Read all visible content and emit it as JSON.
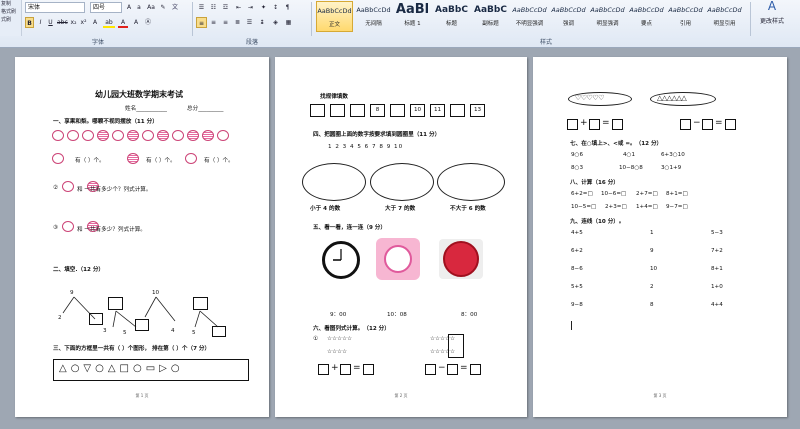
{
  "ribbon": {
    "clipboard_labels": [
      "复制",
      "格式刷",
      "式刷"
    ],
    "font_name": "宋体",
    "font_size": "四号",
    "font_group_label": "字体",
    "paragraph_group_label": "段落",
    "styles_group_label": "样式",
    "change_styles_label": "更改样式",
    "styles": [
      {
        "sample": "AaBbCcDd",
        "name": "正文"
      },
      {
        "sample": "AaBbCcDd",
        "name": "无间隔"
      },
      {
        "sample": "AaBl",
        "name": "标题 1"
      },
      {
        "sample": "AaBbC",
        "name": "标题"
      },
      {
        "sample": "AaBbC",
        "name": "副标题"
      },
      {
        "sample": "AaBbCcDd",
        "name": "不明显强调"
      },
      {
        "sample": "AaBbCcDd",
        "name": "强调"
      },
      {
        "sample": "AaBbCcDd",
        "name": "明显强调"
      },
      {
        "sample": "AaBbCcDd",
        "name": "要点"
      },
      {
        "sample": "AaBbCcDd",
        "name": "引用"
      },
      {
        "sample": "AaBbCcDd",
        "name": "明显引用"
      }
    ]
  },
  "page1": {
    "title": "幼儿园大班数学期末考试",
    "name_label": "姓名___________",
    "score_label": "总分_________",
    "s1": "一、享果和梨。哪颗不视同摆放（11 分）",
    "row_marks": [
      "有（    ）个。",
      "有（    ）个。",
      "有（    ）个。"
    ],
    "q2": "和       一共有多少个？列式计算。",
    "q3": "和       一共有多少？列式计算。",
    "s2": "二、填空.（12 分）",
    "tree1": {
      "top": "9",
      "left": "2",
      "mid": "3"
    },
    "tree2": {
      "top": "10",
      "left": "5",
      "mid": "4",
      "right": "5"
    },
    "s3": "三、下面的方框里一共有（    ）个图形，  排在第（    ）个（7 分）",
    "page_num": "第 1 页"
  },
  "page2": {
    "s_find": "找规律填数",
    "seq": [
      "",
      "",
      "",
      "8",
      "",
      "10",
      "11",
      "",
      "13"
    ],
    "s4": "四、把圆圈上面的数字按要求填到圆圈里（11 分）",
    "numbers": "1   2   3   4   5   6   7   8   9   10",
    "oval_labels": [
      "小于 4 的数",
      "大于 7 的数",
      "不大于 6 的数"
    ],
    "s5": "五、看一看，连一连（9 分）",
    "times": [
      "9：00",
      "10：08",
      "8：00"
    ],
    "s6": "六、看图列式计算。（12 分）",
    "q1": "①",
    "stars1": "☆☆☆☆☆",
    "stars2": "☆☆☆☆",
    "stars3": "☆☆☆☆☆",
    "stars4": "☆☆☆☆☆",
    "plus": "+",
    "minus": "−",
    "eq": "=",
    "page_num": "第 2 页"
  },
  "page3": {
    "s7": "七、在○填上>、<或 =。（12 分）",
    "compare": [
      [
        "9○6",
        "4○1",
        "6+3○10"
      ],
      [
        "8○3",
        "10−8○8",
        "3○1+9"
      ]
    ],
    "s8": "八、计算（16 分）",
    "calc": [
      [
        "6+2=□",
        "10−6=□",
        "2+7=□",
        "8+1=□"
      ],
      [
        "10−5=□",
        "2+3=□",
        "1+4=□",
        "9−7=□"
      ]
    ],
    "s9": "九、连线（10 分）。",
    "link": [
      [
        "4+5",
        "1",
        "5−3"
      ],
      [
        "6+2",
        "9",
        "7+2"
      ],
      [
        "8−6",
        "10",
        "8+1"
      ],
      [
        "5+5",
        "2",
        "1+0"
      ],
      [
        "9−8",
        "8",
        "4+4"
      ]
    ],
    "plus": "+",
    "minus": "−",
    "eq": "=",
    "page_num": "第 3 页"
  }
}
